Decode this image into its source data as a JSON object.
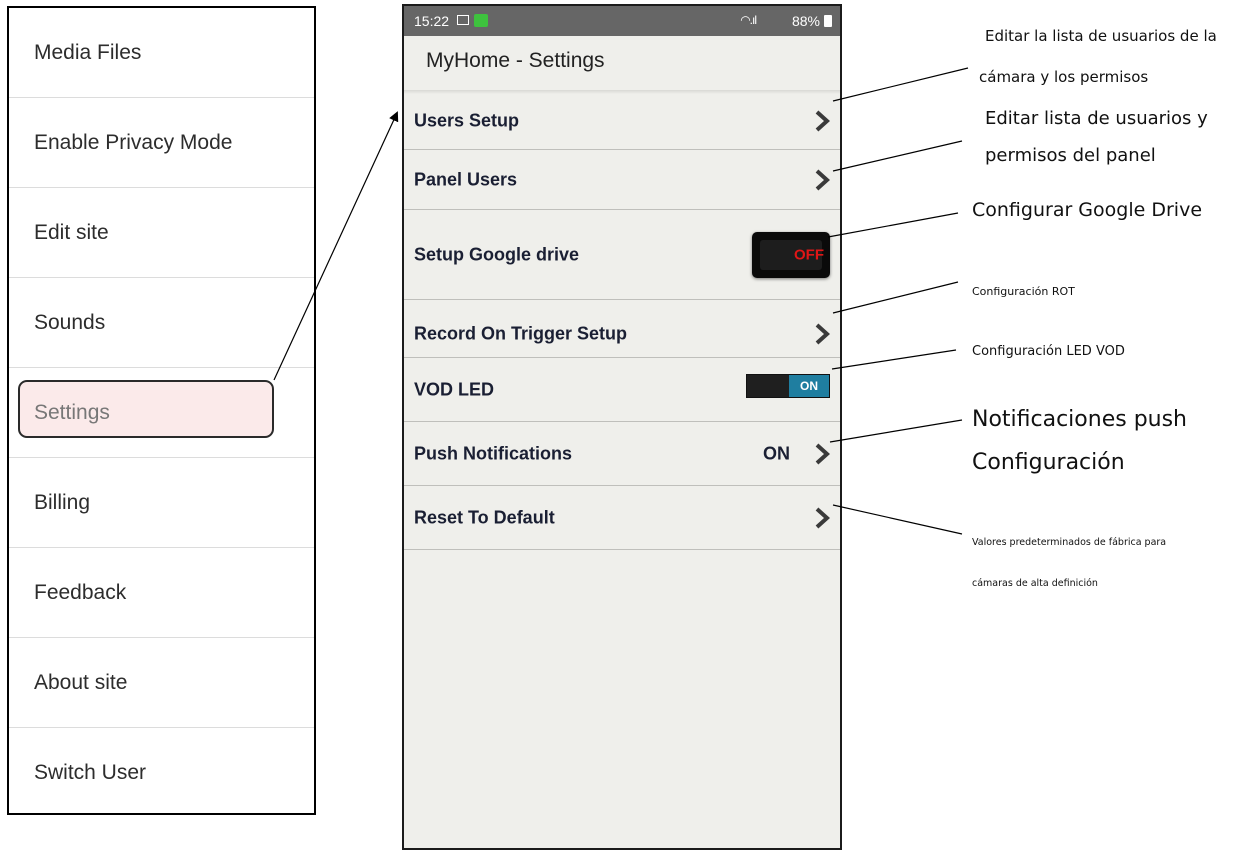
{
  "left_menu": {
    "items": [
      {
        "label": "Media Files"
      },
      {
        "label": "Enable Privacy Mode"
      },
      {
        "label": "Edit site"
      },
      {
        "label": "Sounds"
      },
      {
        "label": "Settings"
      },
      {
        "label": "Billing"
      },
      {
        "label": "Feedback"
      },
      {
        "label": "About site"
      },
      {
        "label": "Switch User"
      }
    ]
  },
  "phone": {
    "status_bar": {
      "time": "15:22",
      "battery": "88%",
      "icons": [
        "image-icon",
        "app-notification-icon",
        "wifi-icon",
        "signal-icon",
        "battery-icon"
      ]
    },
    "app_title": "MyHome - Settings",
    "rows": [
      {
        "label": "Users Setup"
      },
      {
        "label": "Panel Users"
      },
      {
        "label": "Setup Google drive",
        "toggle_label": "OFF"
      },
      {
        "label": "Record On Trigger Setup"
      },
      {
        "label": "VOD LED",
        "toggle_label": "ON"
      },
      {
        "label": "Push Notifications",
        "value": "ON"
      },
      {
        "label": "Reset To Default"
      }
    ]
  },
  "annotations": {
    "users_setup_line1": "Editar la lista de usuarios de la",
    "users_setup_line2": "cámara y los permisos",
    "panel_users_line1": "Editar lista de usuarios y",
    "panel_users_line2": "permisos del panel",
    "google_drive": "Configurar Google Drive",
    "rot": "Configuración ROT",
    "vod_led": "Configuración LED VOD",
    "push_line1": "Notificaciones push",
    "push_line2": "Configuración",
    "reset_line1": "Valores predeterminados de fábrica para",
    "reset_line2": "cámaras de alta definición"
  },
  "colors": {
    "status_bar": "#666666",
    "phone_background": "#efefeb",
    "row_text": "#1a1f33",
    "off_label": "#e01616",
    "on_toggle": "#1f7ea0",
    "settings_highlight": "#fbeaea"
  }
}
